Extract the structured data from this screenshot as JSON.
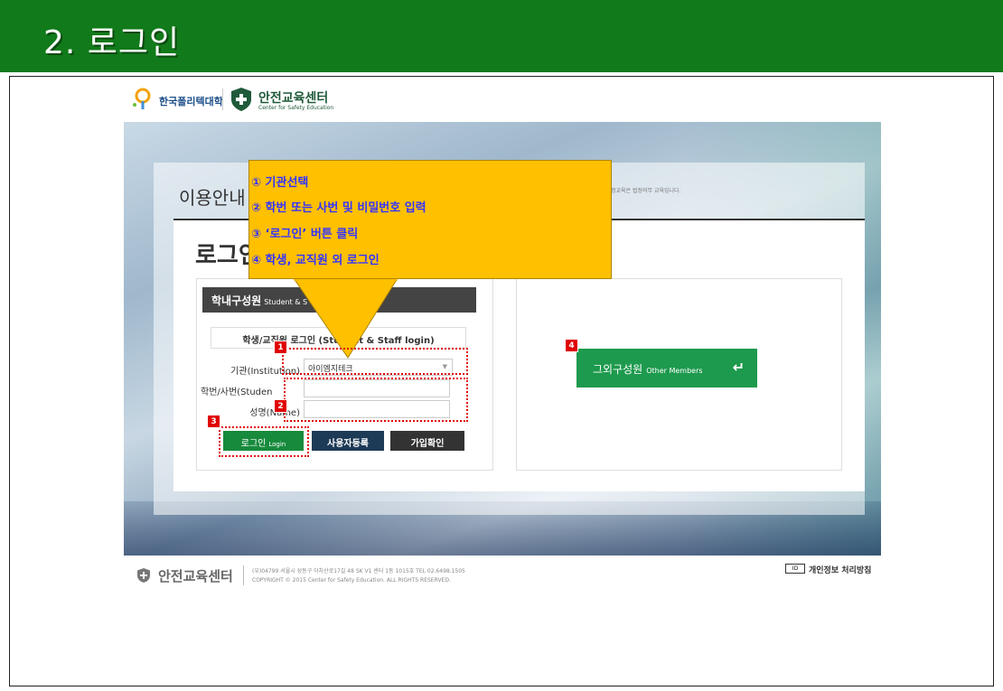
{
  "slide": {
    "title": "2. 로그인"
  },
  "logos": {
    "polytech_name": "한국폴리텍대학",
    "center_name": "안전교육센터",
    "center_name_en": "Center for Safety Education"
  },
  "page": {
    "info_heading": "이용안내",
    "info_desc": "정교육은 법정의무 교육입니다.",
    "login_heading": "로그인"
  },
  "members": {
    "tab_label": "학내구성원",
    "tab_label_en": "Student & S",
    "sub_label": "학생/교직원 로그인 (Student & Staff login)",
    "institution_label": "기관(Institution)",
    "institution_value": "아이엠지테크",
    "id_label": "학번/사번(Studen",
    "password_label": "성명(Name)",
    "login_button": "로그인",
    "login_button_en": "Login",
    "register_button": "사용자등록",
    "check_button": "가입확인"
  },
  "others": {
    "button_label": "그외구성원",
    "button_label_en": "Other Members",
    "button_arrow": "↵"
  },
  "footer": {
    "name": "안전교육센터",
    "address": "(우)04799 서울시 성동구 아차산로17길 48 SK V1 센터 1동 1015호 TEL 02.6498.1505",
    "copyright": "COPYRIGHT © 2015 Center for Safety Education. ALL RIGHTS RESERVED.",
    "privacy_icon": "ID",
    "privacy": "개인정보 처리방침"
  },
  "callout": {
    "step1": "① 기관선택",
    "step2": "② 학번 또는 사번 및 비밀번호 입력",
    "step3": "③ ‘로그인’ 버튼 클릭",
    "step4": "④ 학생, 교직원 외 로그인"
  },
  "badges": {
    "b1": "1",
    "b2": "2",
    "b3": "3",
    "b4": "4"
  },
  "colors": {
    "header_green": "#117a1a",
    "callout_yellow": "#ffc000",
    "callout_text": "#3333ff",
    "marker_red": "#e00000",
    "login_green": "#178a3c",
    "register_navy": "#1d3a56"
  }
}
